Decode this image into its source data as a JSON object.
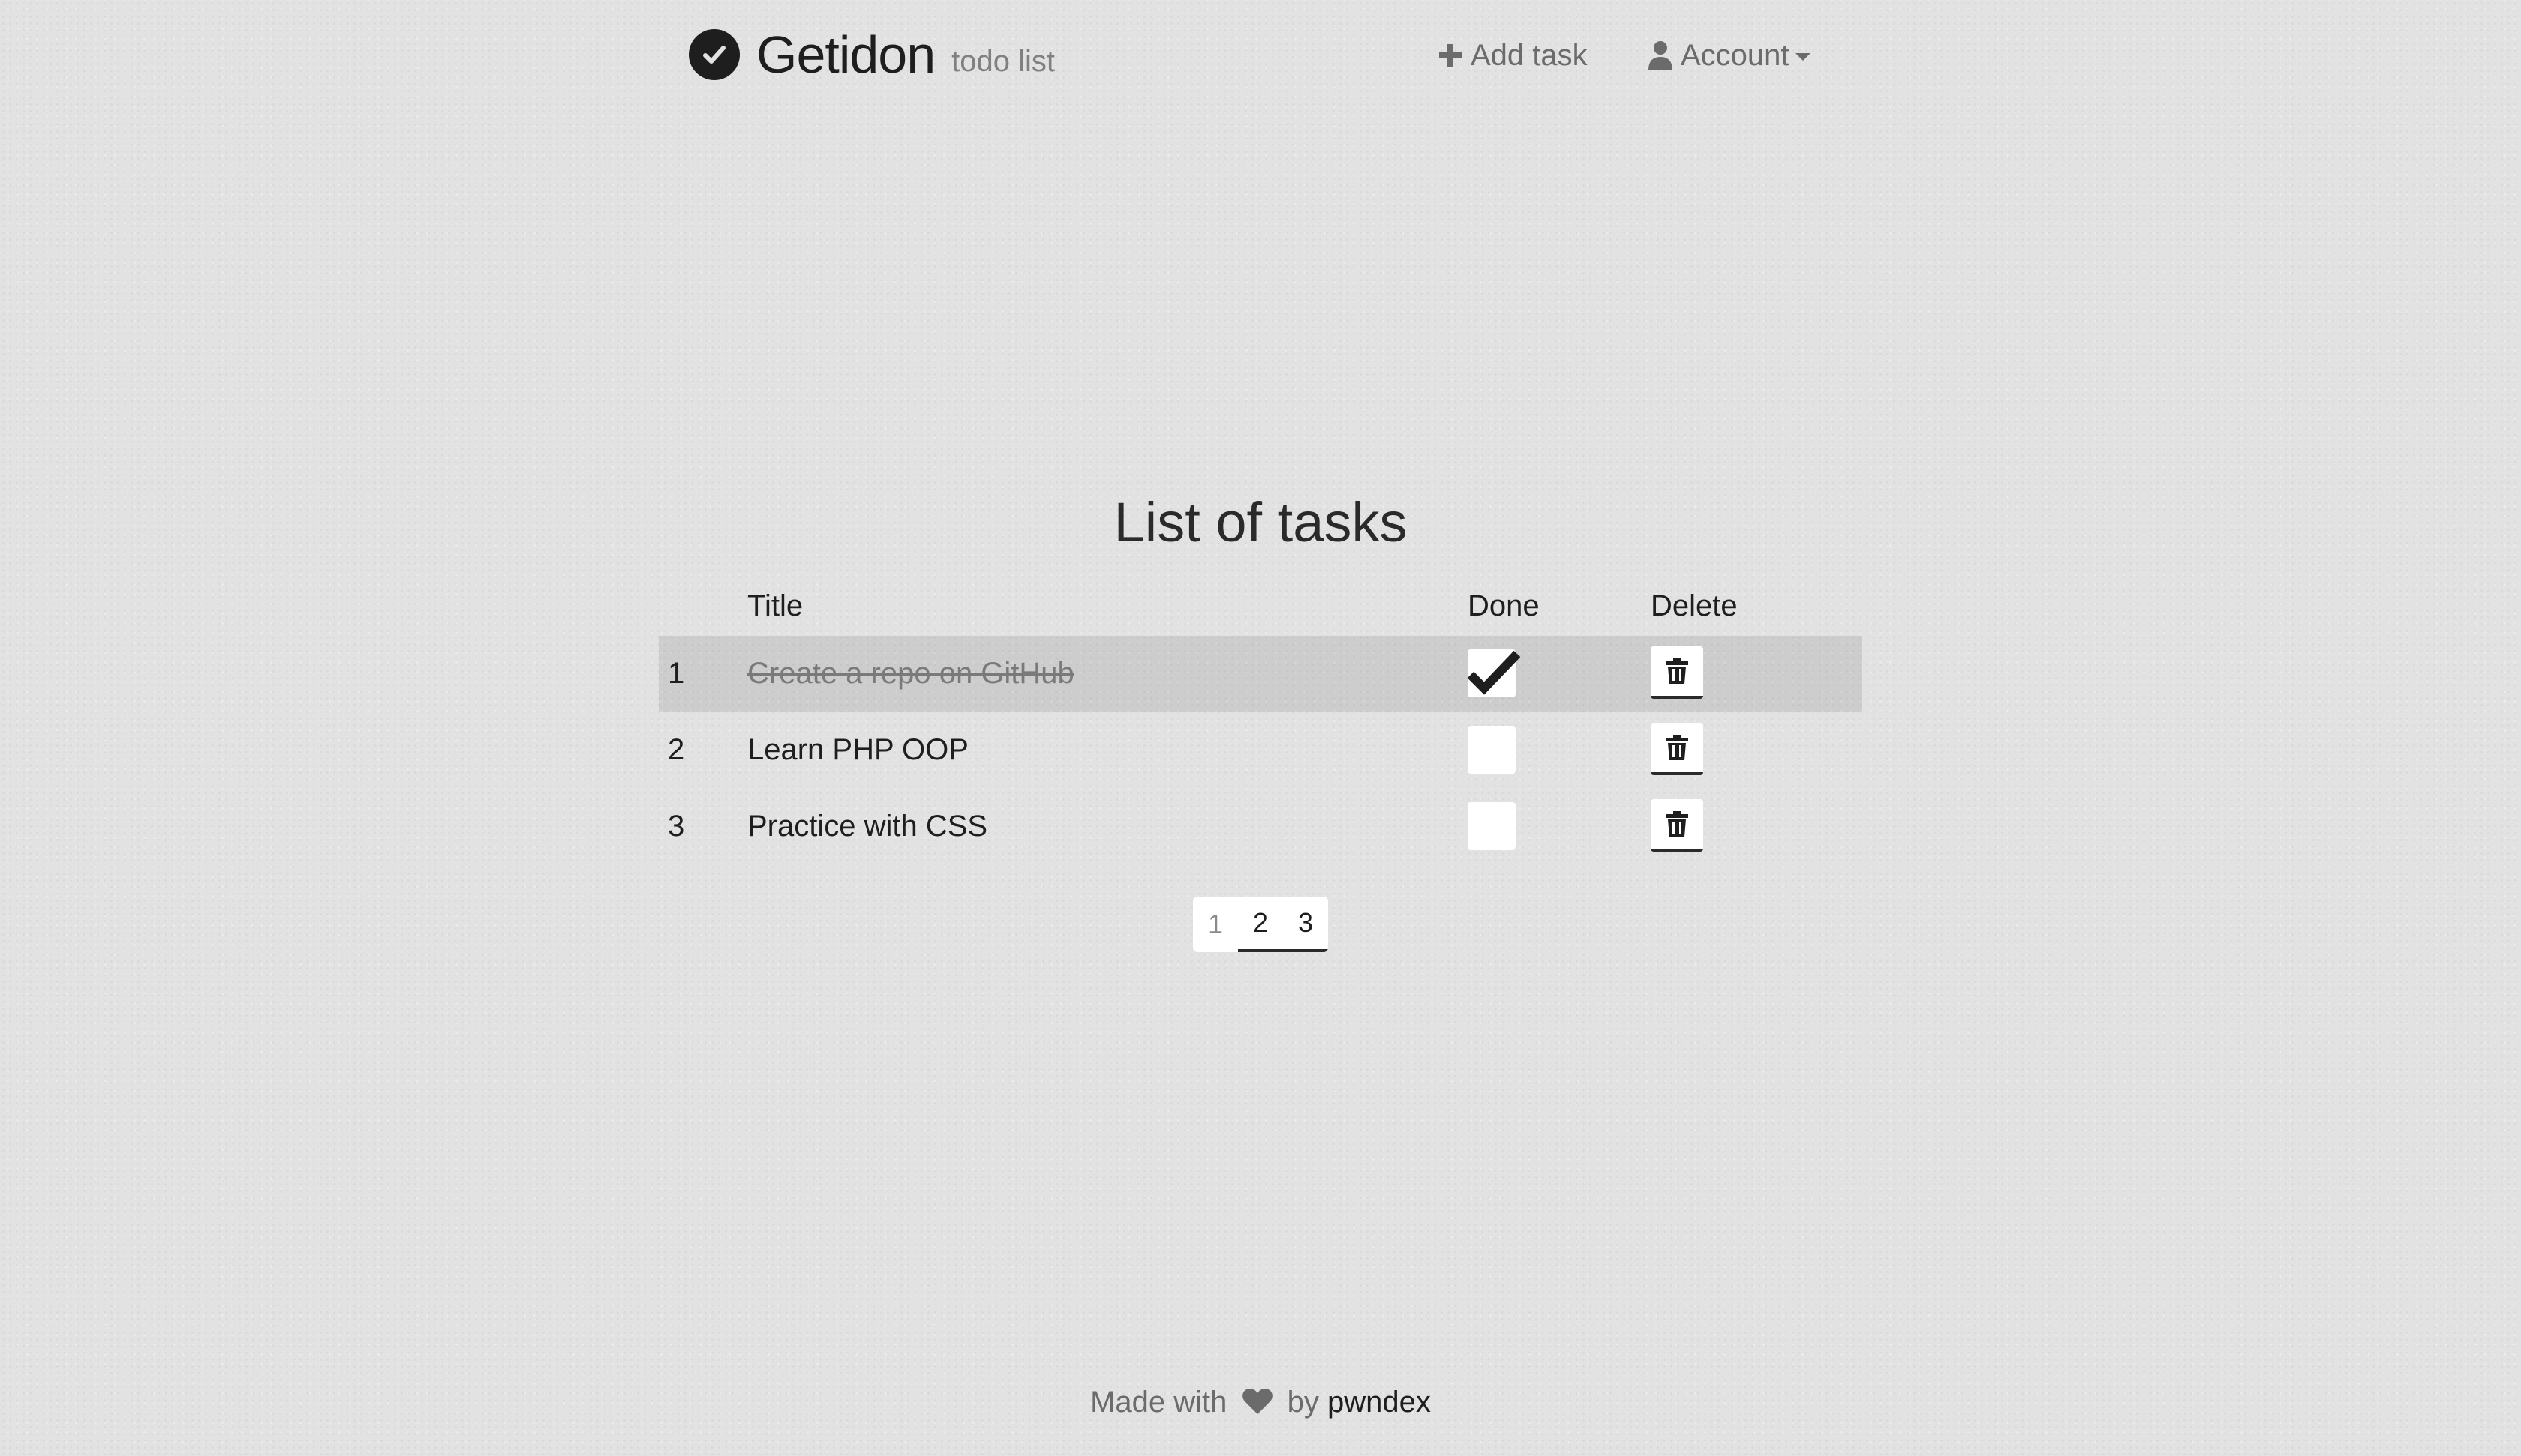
{
  "brand": {
    "name": "Getidon",
    "tagline": "todo list",
    "icon": "check-circle-icon"
  },
  "nav": {
    "add_task_label": "Add task",
    "add_task_icon": "plus-icon",
    "account_label": "Account",
    "account_icon": "user-icon"
  },
  "main": {
    "title": "List of tasks",
    "columns": {
      "title": "Title",
      "done": "Done",
      "delete": "Delete"
    },
    "tasks": [
      {
        "num": "1",
        "title": "Create a repo on GitHub",
        "done": true
      },
      {
        "num": "2",
        "title": "Learn PHP OOP",
        "done": false
      },
      {
        "num": "3",
        "title": "Practice with CSS",
        "done": false
      }
    ]
  },
  "pagination": {
    "pages": [
      "1",
      "2",
      "3"
    ],
    "current": "1"
  },
  "footer": {
    "made_with": "Made with",
    "by": "by",
    "author": "pwndex",
    "icon": "heart-icon"
  },
  "colors": {
    "background": "#e2e2e2",
    "text": "#1e1e1e",
    "muted": "#6b6b6b",
    "completed_row": "#d0d0d0"
  }
}
